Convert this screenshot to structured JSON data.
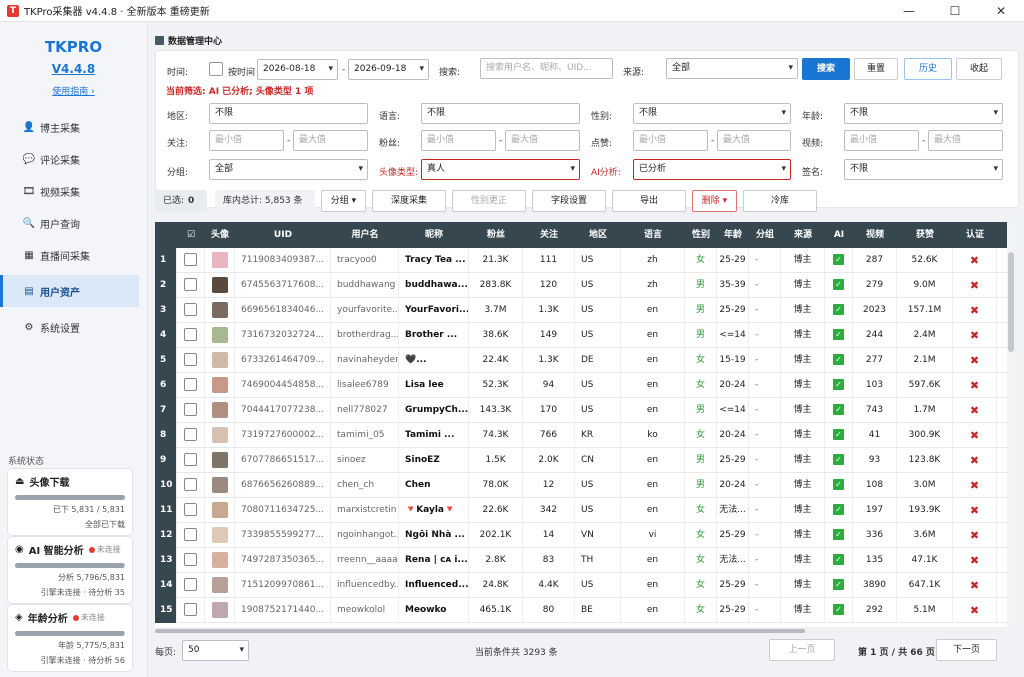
{
  "window": {
    "title": "TKPro采集器 v4.4.8 · 全新版本 重磅更新",
    "min": "—",
    "max": "☐",
    "close": "✕"
  },
  "sidebar": {
    "brand": "TKPRO",
    "version": "V4.4.8",
    "guide": "使用指南 ›",
    "items": [
      {
        "label": "博主采集",
        "icon": "👤"
      },
      {
        "label": "评论采集",
        "icon": "💬"
      },
      {
        "label": "视频采集",
        "icon": "🎞"
      },
      {
        "label": "用户查询",
        "icon": "🔍"
      },
      {
        "label": "直播间采集",
        "icon": "▦"
      },
      {
        "label": "用户资产",
        "icon": "▤"
      },
      {
        "label": "系统设置",
        "icon": "⚙"
      }
    ],
    "status_title": "系统状态",
    "cards": [
      {
        "title": "头像下载",
        "icon": "⏏",
        "status": "",
        "progress": 1.0,
        "line1": "已下 5,831 / 5,831",
        "line2": "全部已下载"
      },
      {
        "title": "AI 智能分析",
        "icon": "◉",
        "status": "未连接",
        "progress": 0.994,
        "line1": "分析 5,796/5,831",
        "line2": "引擎未连接 · 待分析 35"
      },
      {
        "title": "年龄分析",
        "icon": "◈",
        "status": "未连接",
        "progress": 0.99,
        "line1": "年龄 5,775/5,831",
        "line2": "引擎未连接 · 待分析 56"
      }
    ]
  },
  "main": {
    "title": "数据管理中心",
    "filters": {
      "time_label": "时间:",
      "by_time_label": "按时间",
      "date_from": "2026-08-18",
      "date_sep": "-",
      "date_to": "2026-09-18",
      "search_label": "搜索:",
      "search_placeholder": "搜索用户名、昵称、UID...",
      "source_label": "来源:",
      "source_value": "全部",
      "btn_search": "搜索",
      "btn_reset": "重置",
      "btn_history": "历史",
      "btn_collapse": "收起",
      "tip": "当前筛选: AI 已分析; 头像类型 1 项",
      "region_label": "地区:",
      "region_value": "不限",
      "lang_label": "语言:",
      "lang_value": "不限",
      "gender_label": "性别:",
      "gender_value": "不限",
      "age_label": "年龄:",
      "age_value": "不限",
      "follow_label": "关注:",
      "fans_label": "粉丝:",
      "likes_label": "点赞:",
      "video_label": "视频:",
      "min_ph": "最小值",
      "max_ph": "最大值",
      "group_label": "分组:",
      "group_value": "全部",
      "avatar_label": "头像类型:",
      "avatar_value": "真人",
      "ai_label": "AI分析:",
      "ai_value": "已分析",
      "sign_label": "签名:",
      "sign_value": "不限"
    },
    "toolbar": {
      "selected_label": "已选:",
      "selected_count": "0",
      "total": "库内总计: 5,853 条",
      "btn_group": "分组",
      "btn_deep": "深度采集",
      "btn_gender": "性别更正",
      "btn_fields": "字段设置",
      "btn_export": "导出",
      "btn_delete": "删除",
      "btn_cold": "冷库"
    },
    "table": {
      "headers": [
        "",
        "☑",
        "头像",
        "UID",
        "用户名",
        "昵称",
        "粉丝",
        "关注",
        "地区",
        "语言",
        "性别",
        "年龄",
        "分组",
        "来源",
        "AI",
        "视频",
        "获赞",
        "认证"
      ],
      "rows": [
        {
          "n": "1",
          "uid": "7119083409387...",
          "user": "tracyoo0",
          "nick": "Tracy Tea ...",
          "fans": "21.3K",
          "follow": "111",
          "region": "US",
          "lang": "zh",
          "gender": "女",
          "age": "25-29",
          "group": "-",
          "src": "博主",
          "video": "287",
          "likes": "52.6K",
          "av": "#e8b4c0"
        },
        {
          "n": "2",
          "uid": "6745563717608...",
          "user": "buddhawang",
          "nick": "buddhawa...",
          "fans": "283.8K",
          "follow": "120",
          "region": "US",
          "lang": "zh",
          "gender": "男",
          "age": "35-39",
          "group": "-",
          "src": "博主",
          "video": "279",
          "likes": "9.0M",
          "av": "#5a4a3e"
        },
        {
          "n": "3",
          "uid": "6696561834046...",
          "user": "yourfavorite...",
          "nick": "YourFavori...",
          "fans": "3.7M",
          "follow": "1.3K",
          "region": "US",
          "lang": "en",
          "gender": "男",
          "age": "25-29",
          "group": "-",
          "src": "博主",
          "video": "2023",
          "likes": "157.1M",
          "av": "#7a6a60"
        },
        {
          "n": "4",
          "uid": "7316732032724...",
          "user": "brotherdrag...",
          "nick": "Brother ...",
          "fans": "38.6K",
          "follow": "149",
          "region": "US",
          "lang": "en",
          "gender": "男",
          "age": "<=14",
          "group": "-",
          "src": "博主",
          "video": "244",
          "likes": "2.4M",
          "av": "#a8b890"
        },
        {
          "n": "5",
          "uid": "6733261464709...",
          "user": "navinaheyden",
          "nick": "🖤...",
          "fans": "22.4K",
          "follow": "1.3K",
          "region": "DE",
          "lang": "en",
          "gender": "女",
          "age": "15-19",
          "group": "-",
          "src": "博主",
          "video": "277",
          "likes": "2.1M",
          "av": "#d0b8a8"
        },
        {
          "n": "6",
          "uid": "7469004454858...",
          "user": "lisalee6789",
          "nick": "Lisa lee",
          "fans": "52.3K",
          "follow": "94",
          "region": "US",
          "lang": "en",
          "gender": "女",
          "age": "20-24",
          "group": "-",
          "src": "博主",
          "video": "103",
          "likes": "597.6K",
          "av": "#c89888"
        },
        {
          "n": "7",
          "uid": "7044417077238...",
          "user": "nell778027",
          "nick": "GrumpyCh...",
          "fans": "143.3K",
          "follow": "170",
          "region": "US",
          "lang": "en",
          "gender": "男",
          "age": "<=14",
          "group": "-",
          "src": "博主",
          "video": "743",
          "likes": "1.7M",
          "av": "#b09080"
        },
        {
          "n": "8",
          "uid": "7319727600002...",
          "user": "tamimi_05",
          "nick": "Tamimi ...",
          "fans": "74.3K",
          "follow": "766",
          "region": "KR",
          "lang": "ko",
          "gender": "女",
          "age": "20-24",
          "group": "-",
          "src": "博主",
          "video": "41",
          "likes": "300.9K",
          "av": "#d8c0b0"
        },
        {
          "n": "9",
          "uid": "6707786651517...",
          "user": "sinoez",
          "nick": "SinoEZ",
          "fans": "1.5K",
          "follow": "2.0K",
          "region": "CN",
          "lang": "en",
          "gender": "男",
          "age": "25-29",
          "group": "-",
          "src": "博主",
          "video": "93",
          "likes": "123.8K",
          "av": "#807468"
        },
        {
          "n": "10",
          "uid": "6876656260889...",
          "user": "chen_ch",
          "nick": "Chen",
          "fans": "78.0K",
          "follow": "12",
          "region": "US",
          "lang": "en",
          "gender": "男",
          "age": "20-24",
          "group": "-",
          "src": "博主",
          "video": "108",
          "likes": "3.0M",
          "av": "#9a8a80"
        },
        {
          "n": "11",
          "uid": "7080711634725...",
          "user": "marxistcretin",
          "nick": "🔻Kayla🔻",
          "fans": "22.6K",
          "follow": "342",
          "region": "US",
          "lang": "en",
          "gender": "女",
          "age": "无法...",
          "group": "-",
          "src": "博主",
          "video": "197",
          "likes": "193.9K",
          "av": "#c8a890"
        },
        {
          "n": "12",
          "uid": "7339855599277...",
          "user": "ngoinhangot...",
          "nick": "Ngôi Nhà ...",
          "fans": "202.1K",
          "follow": "14",
          "region": "VN",
          "lang": "vi",
          "gender": "女",
          "age": "25-29",
          "group": "-",
          "src": "博主",
          "video": "336",
          "likes": "3.6M",
          "av": "#e0c8b8"
        },
        {
          "n": "13",
          "uid": "7497287350365...",
          "user": "rreenn__aaaa",
          "nick": "Rena | ᴄᴀ i...",
          "fans": "2.8K",
          "follow": "83",
          "region": "TH",
          "lang": "en",
          "gender": "女",
          "age": "无法...",
          "group": "-",
          "src": "博主",
          "video": "135",
          "likes": "47.1K",
          "av": "#d8b0a0"
        },
        {
          "n": "14",
          "uid": "7151209970861...",
          "user": "influencedby...",
          "nick": "Influenced...",
          "fans": "24.8K",
          "follow": "4.4K",
          "region": "US",
          "lang": "en",
          "gender": "女",
          "age": "25-29",
          "group": "-",
          "src": "博主",
          "video": "3890",
          "likes": "647.1K",
          "av": "#b8a098"
        },
        {
          "n": "15",
          "uid": "1908752171440...",
          "user": "meowkolol",
          "nick": "Meowko",
          "fans": "465.1K",
          "follow": "80",
          "region": "BE",
          "lang": "en",
          "gender": "女",
          "age": "25-29",
          "group": "-",
          "src": "博主",
          "video": "292",
          "likes": "5.1M",
          "av": "#c0a8b0"
        }
      ]
    },
    "footer": {
      "per_page_label": "每页:",
      "per_page": "50",
      "summary": "当前条件共 3293 条",
      "prev": "上一页",
      "page_info": "第 1 页 / 共 66 页",
      "next": "下一页"
    }
  }
}
